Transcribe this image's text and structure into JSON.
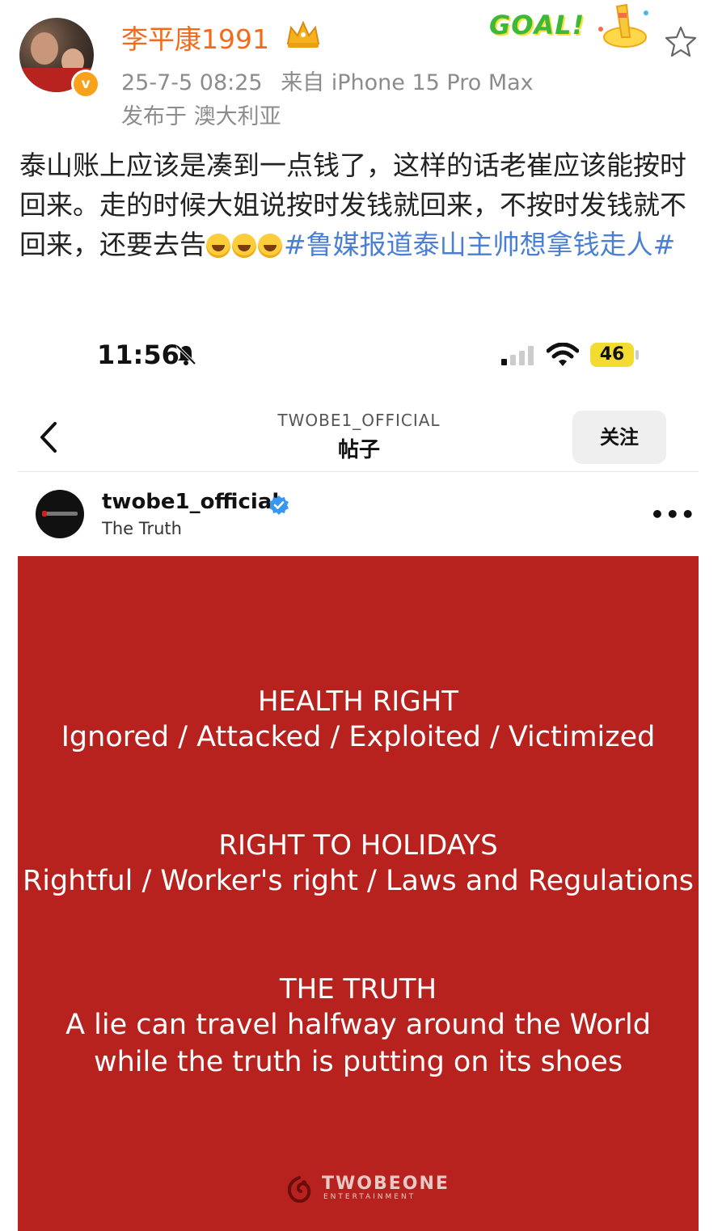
{
  "post": {
    "author": "李平康1991",
    "datetime": "25-7-5 08:25",
    "source": "来自 iPhone 15 Pro Max",
    "location": "发布于 澳大利亚",
    "badge_text": "GOAL!",
    "verified_mark": "v",
    "text_before": "泰山账上应该是凑到一点钱了，这样的话老崔应该能按时回来。走的时候大姐说按时发钱就回来，不按时发钱就不回来，还要去告",
    "hashtag": "#鲁媒报道泰山主帅想拿钱走人#",
    "emoji_count": 3,
    "star_icon": "star-outline-icon"
  },
  "screenshot": {
    "status": {
      "time": "11:56",
      "battery": "46"
    },
    "nav": {
      "account": "TWOBE1_OFFICIAL",
      "title": "帖子",
      "follow": "关注"
    },
    "ig_post": {
      "username": "twobe1_official",
      "subtitle": "The Truth",
      "more": "•••"
    },
    "card": {
      "bg_color": "#b8221e",
      "blocks": [
        {
          "heading": "HEALTH RIGHT",
          "sub": "Ignored / Attacked / Exploited / Victimized"
        },
        {
          "heading": "RIGHT TO HOLIDAYS",
          "sub": "Rightful / Worker's right / Laws and Regulations"
        },
        {
          "heading": "THE TRUTH",
          "sub": "A lie can travel halfway around the World",
          "sub2": "while the truth is putting on its shoes"
        }
      ],
      "logo_text": "TWOBEONE",
      "logo_sub": "ENTERTAINMENT"
    }
  },
  "colors": {
    "author": "#f26b1d",
    "meta": "#8c8c8c",
    "hashtag": "#4a7fd4",
    "follow_bg": "#efefef",
    "battery": "#f2dc32"
  }
}
